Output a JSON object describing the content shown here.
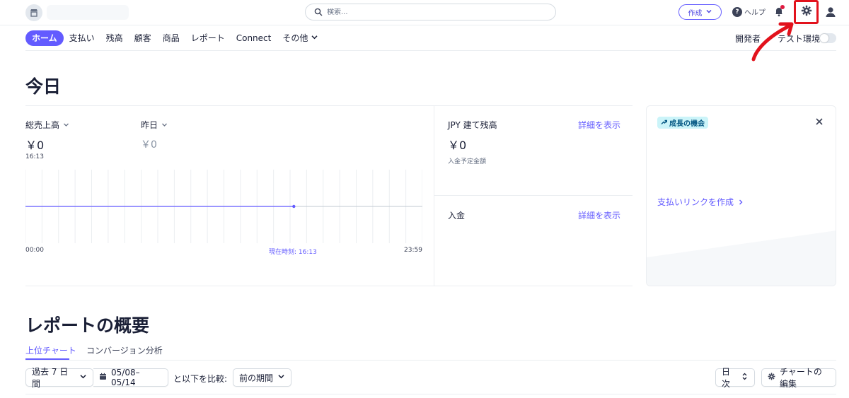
{
  "header": {
    "search_placeholder": "検索...",
    "create_label": "作成",
    "help_label": "ヘルプ",
    "help_glyph": "?"
  },
  "nav": {
    "items": [
      "ホーム",
      "支払い",
      "残高",
      "顧客",
      "商品",
      "レポート",
      "Connect"
    ],
    "more_label": "その他",
    "developer_label": "開発者",
    "test_env_label": "テスト環境"
  },
  "today": {
    "title": "今日",
    "gross_label": "総売上高",
    "gross_value": "￥0",
    "gross_time": "16:13",
    "yesterday_label": "昨日",
    "yesterday_value": "￥0",
    "axis_start": "00:00",
    "axis_now": "現在時刻: 16:13",
    "axis_end": "23:59",
    "balance_title": "JPY 建て残高",
    "balance_value": "￥0",
    "balance_sub": "入金予定金額",
    "details_link": "詳細を表示",
    "payouts_title": "入金",
    "payouts_link": "詳細を表示"
  },
  "growth": {
    "badge": "成長の機会",
    "link": "支払いリンクを作成"
  },
  "report": {
    "title": "レポートの概要",
    "tab_active": "上位チャート",
    "tab_other": "コンバージョン分析",
    "range": "過去 7 日間",
    "dates": "05/08–05/14",
    "compare_label": "と以下を比較:",
    "compare_value": "前の期間",
    "interval": "日次",
    "edit_charts": "チャートの編集"
  },
  "colors": {
    "accent": "#635bff",
    "annotation": "#e2121c",
    "notification": "#df1b41"
  },
  "chart_data": {
    "type": "line",
    "x_range": [
      "00:00",
      "23:59"
    ],
    "series": [
      {
        "x": [
          "00:00",
          "16:13"
        ],
        "y": [
          0,
          0
        ]
      }
    ],
    "current_time": "16:13",
    "grid": true
  }
}
